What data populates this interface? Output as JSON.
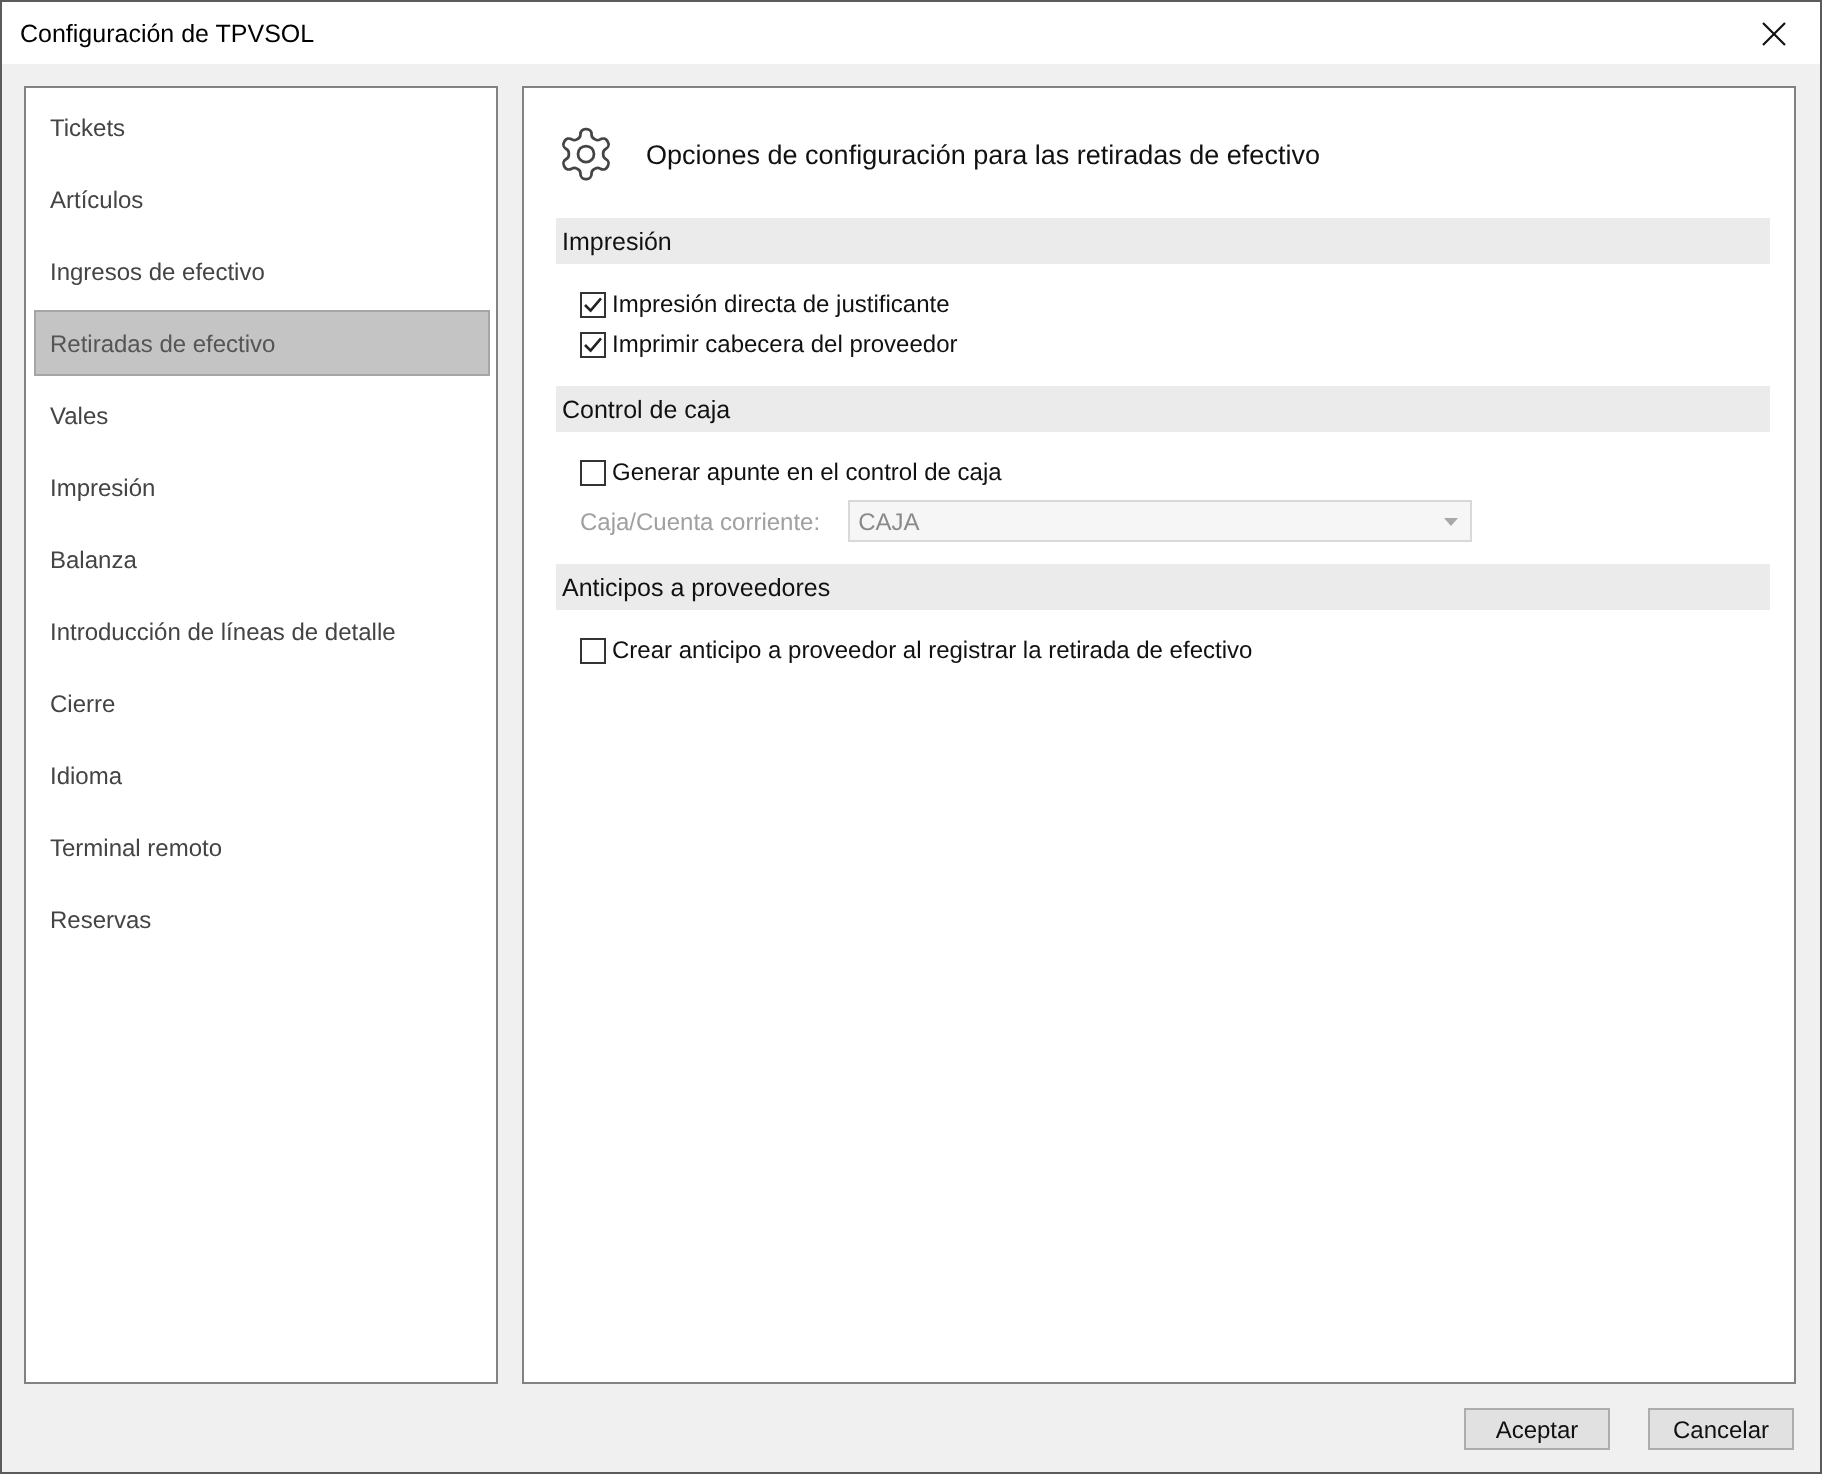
{
  "window": {
    "title": "Configuración de TPVSOL"
  },
  "sidebar": {
    "items": [
      {
        "label": "Tickets",
        "selected": false
      },
      {
        "label": "Artículos",
        "selected": false
      },
      {
        "label": "Ingresos de efectivo",
        "selected": false
      },
      {
        "label": "Retiradas de efectivo",
        "selected": true
      },
      {
        "label": "Vales",
        "selected": false
      },
      {
        "label": "Impresión",
        "selected": false
      },
      {
        "label": "Balanza",
        "selected": false
      },
      {
        "label": "Introducción de líneas de detalle",
        "selected": false
      },
      {
        "label": "Cierre",
        "selected": false
      },
      {
        "label": "Idioma",
        "selected": false
      },
      {
        "label": "Terminal remoto",
        "selected": false
      },
      {
        "label": "Reservas",
        "selected": false
      }
    ]
  },
  "panel": {
    "heading": "Opciones de configuración para las retiradas de efectivo",
    "sections": [
      {
        "title": "Impresión",
        "rows": [
          {
            "kind": "checkbox",
            "label": "Impresión directa de justificante",
            "checked": true
          },
          {
            "kind": "checkbox",
            "label": "Imprimir cabecera del proveedor",
            "checked": true
          }
        ]
      },
      {
        "title": "Control de caja",
        "rows": [
          {
            "kind": "checkbox",
            "label": "Generar apunte en el control de caja",
            "checked": false
          },
          {
            "kind": "select",
            "label": "Caja/Cuenta corriente:",
            "value": "CAJA",
            "disabled": true
          }
        ]
      },
      {
        "title": "Anticipos a proveedores",
        "rows": [
          {
            "kind": "checkbox",
            "label": "Crear anticipo a proveedor al registrar la retirada de efectivo",
            "checked": false
          }
        ]
      }
    ]
  },
  "buttons": [
    "Aceptar",
    "Cancelar"
  ]
}
